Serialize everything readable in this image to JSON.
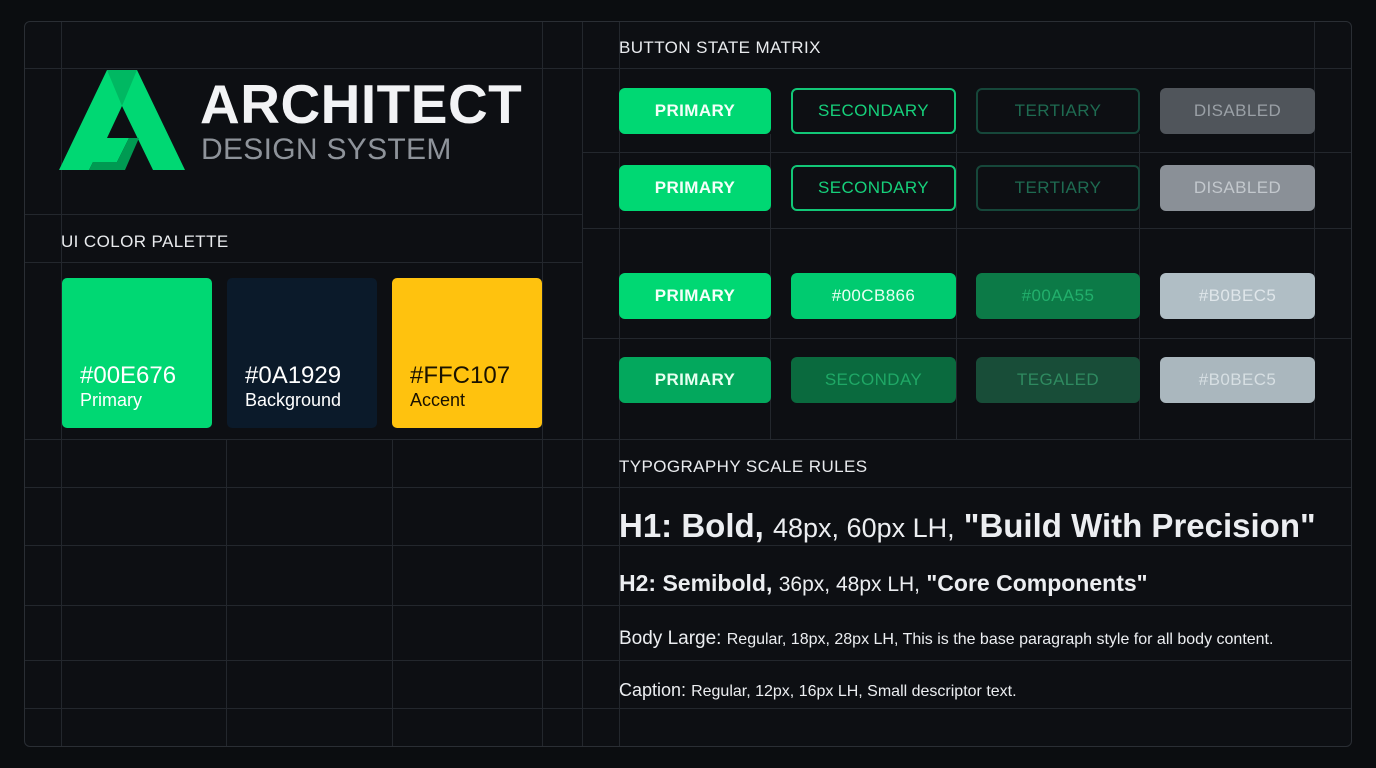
{
  "brand": {
    "title": "ARCHITECT",
    "subtitle": "DESIGN SYSTEM",
    "logo_icon": "architect-a-logo-icon"
  },
  "palette": {
    "heading": "UI COLOR PALETTE",
    "swatches": [
      {
        "hex": "#00E676",
        "name": "Primary",
        "color": "#00d873",
        "text_color": "#ffffff"
      },
      {
        "hex": "#0A1929",
        "name": "Background",
        "color": "#0b1a2a",
        "text_color": "#ffffff"
      },
      {
        "hex": "#FFC107",
        "name": "Accent",
        "color": "#ffc20e",
        "text_color": "#1a1200"
      }
    ]
  },
  "buttons": {
    "heading": "BUTTON STATE MATRIX",
    "rows": [
      [
        "PRIMARY",
        "SECONDARY",
        "TERTIARY",
        "DISABLED"
      ],
      [
        "PRIMARY",
        "SECONDARY",
        "TERTIARY",
        "DISABLED"
      ],
      [
        "PRIMARY",
        "#00CB866",
        "#00AA55",
        "#B0BEC5"
      ],
      [
        "PRIMARY",
        "SECONDAY",
        "TEGALED",
        "#B0BEC5"
      ]
    ]
  },
  "typography": {
    "heading": "TYPOGRAPHY SCALE RULES",
    "h1": {
      "label": "H1: Bold,",
      "spec": "48px, 60px LH,",
      "sample": "\"Build With Precision\""
    },
    "h2": {
      "label": "H2: Semibold,",
      "spec": "36px, 48px LH,",
      "sample": "\"Core Components\""
    },
    "body": {
      "label": "Body Large:",
      "spec": "Regular, 18px, 28px LH, This is the base paragraph style for all body content."
    },
    "caption": {
      "label": "Caption:",
      "spec": "Regular, 12px, 16px LH, Small descriptor text."
    }
  },
  "colors": {
    "primary": "#00E676",
    "background": "#0A1929",
    "accent": "#FFC107",
    "disabled": "#B0BEC5"
  }
}
